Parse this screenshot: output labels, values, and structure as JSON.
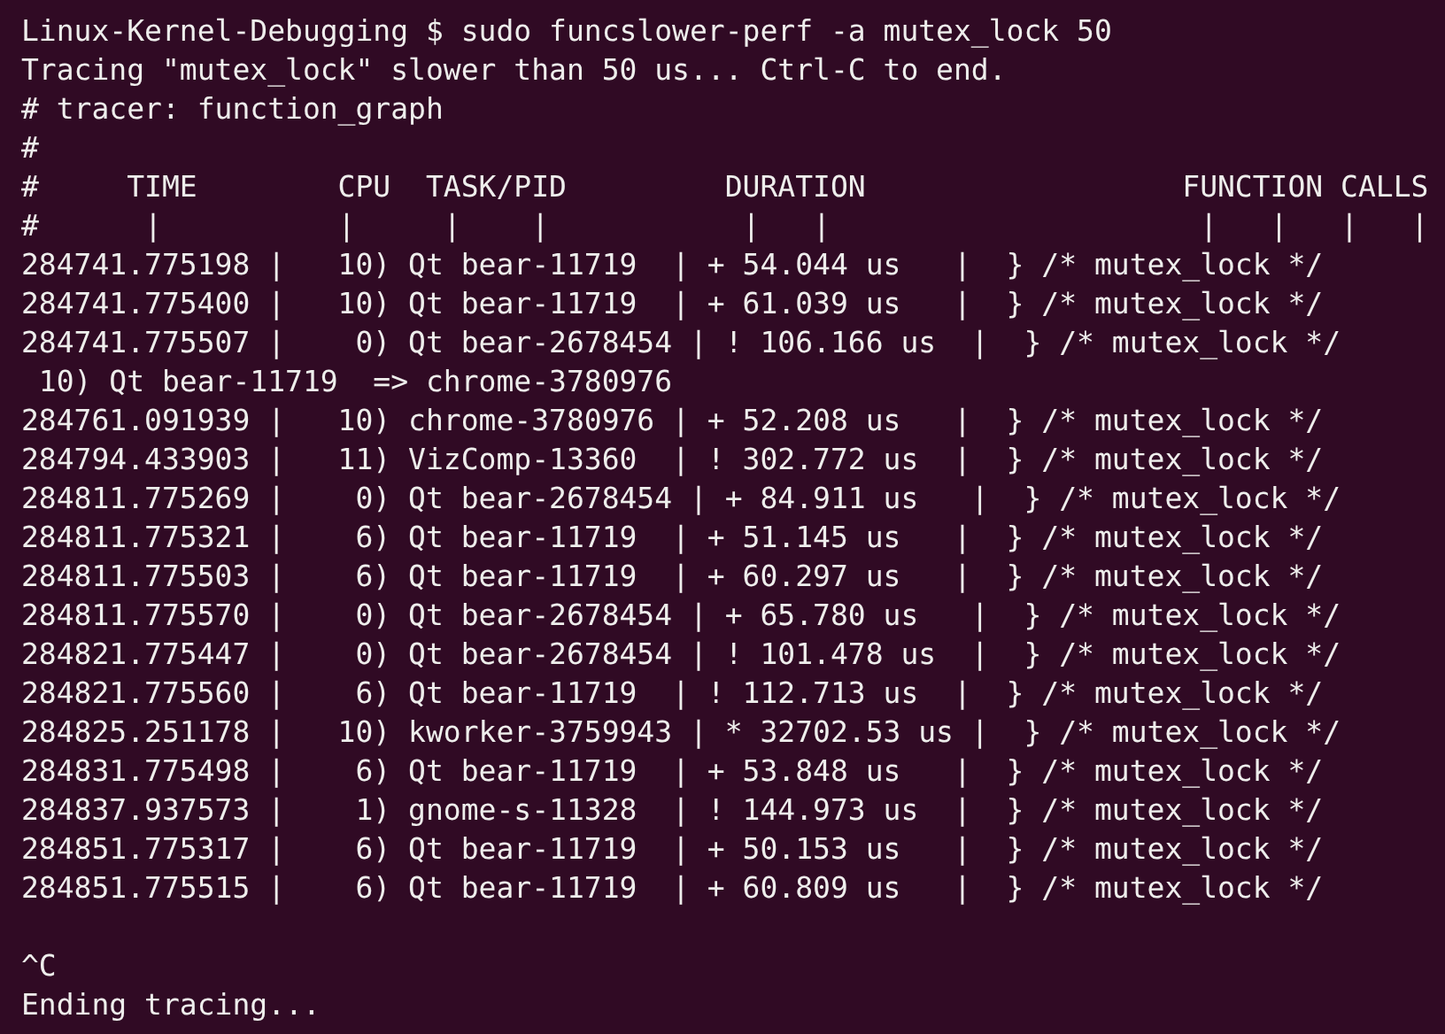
{
  "terminal": {
    "lines": [
      "Linux-Kernel-Debugging $ sudo funcslower-perf -a mutex_lock 50",
      "Tracing \"mutex_lock\" slower than 50 us... Ctrl-C to end.",
      "# tracer: function_graph",
      "#",
      "#     TIME        CPU  TASK/PID         DURATION                  FUNCTION CALLS",
      "#      |          |     |    |           |   |                     |   |   |   |",
      "284741.775198 |   10) Qt bear-11719  | + 54.044 us   |  } /* mutex_lock */",
      "284741.775400 |   10) Qt bear-11719  | + 61.039 us   |  } /* mutex_lock */",
      "284741.775507 |    0) Qt bear-2678454 | ! 106.166 us  |  } /* mutex_lock */",
      " 10) Qt bear-11719  => chrome-3780976",
      "284761.091939 |   10) chrome-3780976 | + 52.208 us   |  } /* mutex_lock */",
      "284794.433903 |   11) VizComp-13360  | ! 302.772 us  |  } /* mutex_lock */",
      "284811.775269 |    0) Qt bear-2678454 | + 84.911 us   |  } /* mutex_lock */",
      "284811.775321 |    6) Qt bear-11719  | + 51.145 us   |  } /* mutex_lock */",
      "284811.775503 |    6) Qt bear-11719  | + 60.297 us   |  } /* mutex_lock */",
      "284811.775570 |    0) Qt bear-2678454 | + 65.780 us   |  } /* mutex_lock */",
      "284821.775447 |    0) Qt bear-2678454 | ! 101.478 us  |  } /* mutex_lock */",
      "284821.775560 |    6) Qt bear-11719  | ! 112.713 us  |  } /* mutex_lock */",
      "284825.251178 |   10) kworker-3759943 | * 32702.53 us |  } /* mutex_lock */",
      "284831.775498 |    6) Qt bear-11719  | + 53.848 us   |  } /* mutex_lock */",
      "284837.937573 |    1) gnome-s-11328  | ! 144.973 us  |  } /* mutex_lock */",
      "284851.775317 |    6) Qt bear-11719  | + 50.153 us   |  } /* mutex_lock */",
      "284851.775515 |    6) Qt bear-11719  | + 60.809 us   |  } /* mutex_lock */"
    ],
    "footer_lines": [
      "^C",
      "Ending tracing..."
    ]
  }
}
